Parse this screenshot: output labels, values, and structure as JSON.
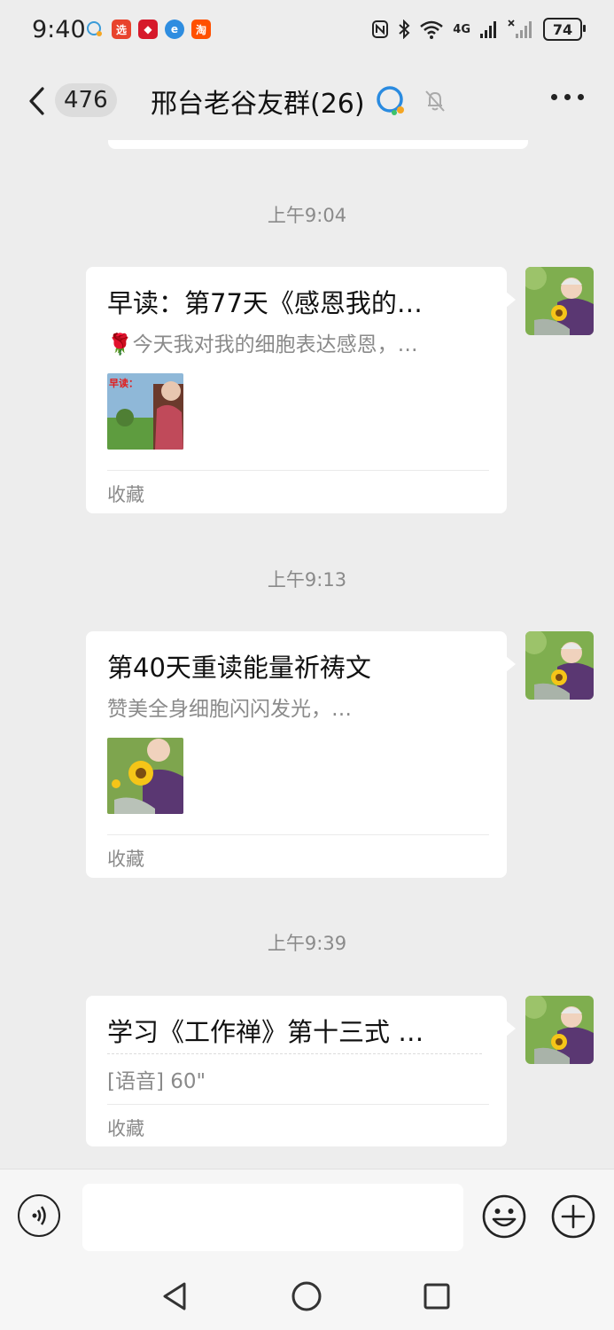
{
  "status_bar": {
    "time": "9:40",
    "battery": "74",
    "network": "4G",
    "app_icons": [
      "chat-bubble-icon",
      "app-icon-red-1",
      "app-icon-red-2",
      "browser-icon",
      "taobao-icon"
    ]
  },
  "header": {
    "unread_count": "476",
    "title": "邢台老谷友群(26)"
  },
  "messages": [
    {
      "time": "上午9:04",
      "title": "早读：第77天《感恩我的…",
      "desc": "🌹今天我对我的细胞表达感恩，…",
      "thumb_text": "早读：",
      "footer": "收藏"
    },
    {
      "time": "上午9:13",
      "title": "第40天重读能量祈祷文",
      "desc": "赞美全身细胞闪闪发光，…",
      "footer": "收藏"
    },
    {
      "time": "上午9:39",
      "title": "学习《工作禅》第十三式  …",
      "desc": "[语音] 60\"",
      "footer": "收藏"
    }
  ],
  "colors": {
    "background": "#ededed",
    "card": "#ffffff",
    "meta_text": "#8a8a8a"
  }
}
